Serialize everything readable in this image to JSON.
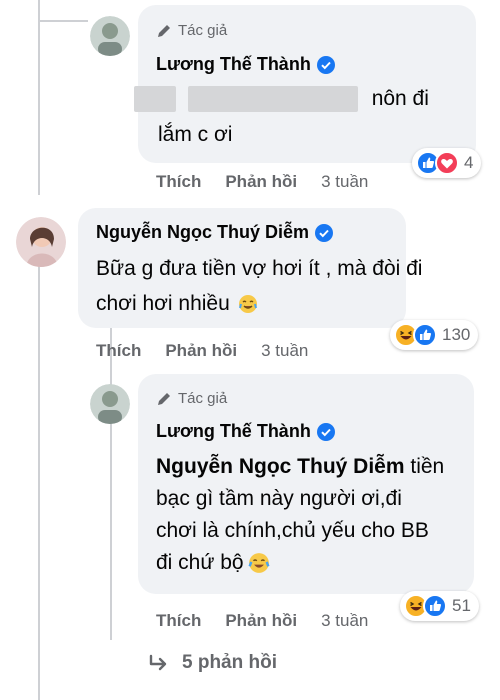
{
  "comments": [
    {
      "author_badge": "Tác giả",
      "author": "Lương Thế Thành",
      "text_suffix": "nôn đi",
      "text_line2": "lắm c ơi",
      "reactions": [
        "like",
        "love"
      ],
      "reaction_count": "4",
      "actions": {
        "like": "Thích",
        "reply": "Phản hồi",
        "time": "3 tuần"
      }
    },
    {
      "author": "Nguyễn Ngọc Thuý Diễm",
      "text_line1": "Bữa g đưa tiền vợ hơi ít , mà đòi đi",
      "text_line2": "chơi hơi nhiều",
      "emoji": "crying-laughing-emoji",
      "reactions": [
        "haha",
        "like"
      ],
      "reaction_count": "130",
      "actions": {
        "like": "Thích",
        "reply": "Phản hồi",
        "time": "3 tuần"
      }
    },
    {
      "author_badge": "Tác giả",
      "author": "Lương Thế Thành",
      "mention": "Nguyễn Ngọc Thuý Diễm",
      "text_part1": "tiền",
      "text_line2": "bạc gì tầm này người ơi,đi",
      "text_line3": "chơi là chính,chủ yếu cho BB",
      "text_line4": "đi chứ bộ",
      "emoji": "tears-of-joy-emoji",
      "reactions": [
        "haha",
        "like"
      ],
      "reaction_count": "51",
      "actions": {
        "like": "Thích",
        "reply": "Phản hồi",
        "time": "3 tuần"
      }
    }
  ],
  "more_replies": {
    "label": "5 phản hồi"
  },
  "colors": {
    "bubble": "#f0f2f5",
    "secondary_text": "#65676b",
    "verified": "#1877f2",
    "like": "#1877f2",
    "love": "#f33e58",
    "haha": "#f7b125"
  }
}
